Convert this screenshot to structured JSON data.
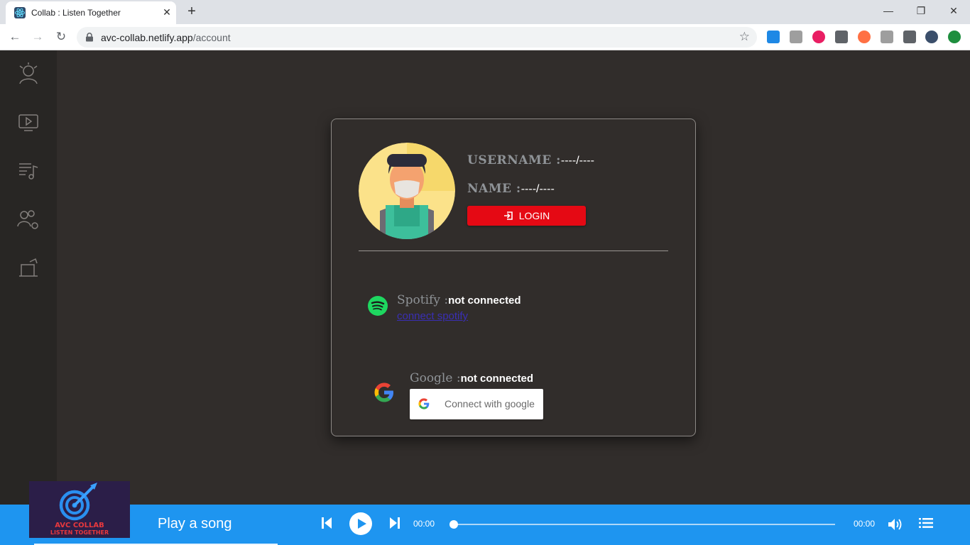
{
  "browser": {
    "tab_title": "Collab : Listen Together",
    "tab_close": "✕",
    "new_tab": "+",
    "url_domain": "avc-collab.netlify.app",
    "url_path": "/account",
    "window_controls": {
      "minimize": "—",
      "restore": "❐",
      "close": "✕"
    }
  },
  "sidebar": {
    "items": [
      {
        "name": "profile-icon"
      },
      {
        "name": "video-icon"
      },
      {
        "name": "playlist-icon"
      },
      {
        "name": "friends-icon"
      },
      {
        "name": "room-icon"
      }
    ]
  },
  "account": {
    "username_label": "USERNAME :",
    "username_value": "----/----",
    "name_label": "NAME :",
    "name_value": "----/----",
    "login_label": "LOGIN",
    "spotify": {
      "label": "Spotify :",
      "status": "not connected",
      "connect_link": "connect spotify"
    },
    "google": {
      "label": "Google :",
      "status": "not connected",
      "button_label": "Connect with google"
    }
  },
  "player": {
    "logo_title": "AVC COLLAB",
    "logo_subtitle": "LISTEN TOGETHER",
    "song_title": "Play a song",
    "time_current": "00:00",
    "time_total": "00:00",
    "progress": 0
  },
  "colors": {
    "background": "#312d2b",
    "sidebar": "#282624",
    "login_button": "#e50914",
    "player_bar": "#1e95f0",
    "spotify_green": "#1ed760"
  }
}
